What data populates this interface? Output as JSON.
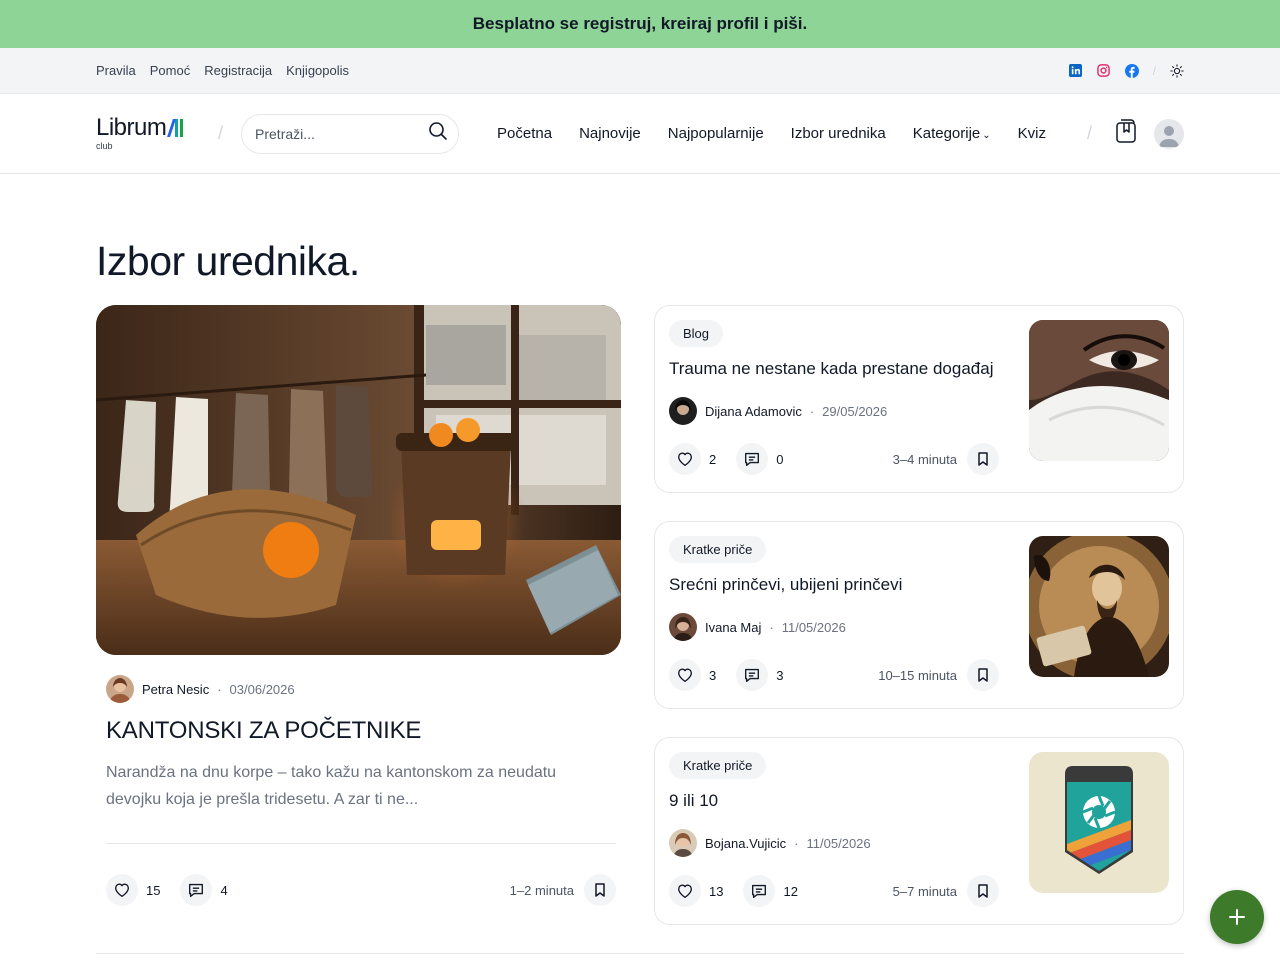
{
  "banner": {
    "text": "Besplatno se registruj, kreiraj profil i piši."
  },
  "topbar": {
    "links": [
      "Pravila",
      "Pomoć",
      "Registracija",
      "Knjigopolis"
    ],
    "social_icons": [
      "linkedin-icon",
      "instagram-icon",
      "facebook-icon",
      "sun-icon"
    ],
    "colors": {
      "linkedin": "#0a66c2",
      "instagram": "#e1306c",
      "facebook": "#1877f2"
    }
  },
  "header": {
    "logo_text": "Librum",
    "logo_sub": "club",
    "search_placeholder": "Pretraži...",
    "nav": [
      "Početna",
      "Najnovije",
      "Najpopularnije",
      "Izbor urednika",
      "Kategorije",
      "Kviz"
    ]
  },
  "page": {
    "title": "Izbor urednika."
  },
  "feature": {
    "author": "Petra Nesic",
    "date": "03/06/2026",
    "title": "KANTONSKI ZA POČETNIKE",
    "excerpt": "Narandža na dnu korpe – tako kažu na kantonskom za neudatu devojku koja je prešla tridesetu. A zar ti ne...",
    "likes": "15",
    "comments": "4",
    "read_time": "1–2 minuta"
  },
  "cards": [
    {
      "category": "Blog",
      "title": "Trauma ne nestane kada prestane događaj",
      "author": "Dijana Adamovic",
      "date": "29/05/2026",
      "likes": "2",
      "comments": "0",
      "read_time": "3–4 minuta"
    },
    {
      "category": "Kratke priče",
      "title": "Srećni prinčevi, ubijeni prinčevi",
      "author": "Ivana Maj",
      "date": "11/05/2026",
      "likes": "3",
      "comments": "3",
      "read_time": "10–15 minuta"
    },
    {
      "category": "Kratke priče",
      "title": "9 ili 10",
      "author": "Bojana.Vujicic",
      "date": "11/05/2026",
      "likes": "13",
      "comments": "12",
      "read_time": "5–7 minuta"
    }
  ],
  "colors": {
    "banner": "#8fd497",
    "fab": "#3d7a2a",
    "accent_blue": "#2563eb"
  }
}
